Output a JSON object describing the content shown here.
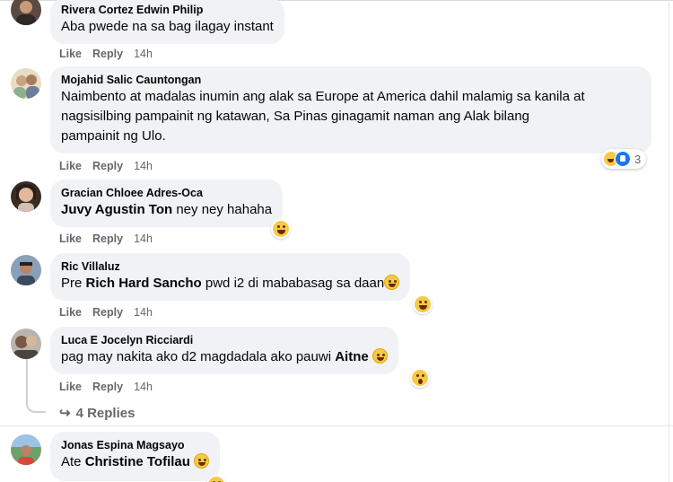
{
  "actions": {
    "like": "Like",
    "reply": "Reply"
  },
  "comments": [
    {
      "author": "Rivera Cortez Edwin Philip",
      "text": "Aba pwede na sa bag ilagay instant",
      "time": "14h"
    },
    {
      "author": "Mojahid Salic Cauntongan",
      "text_lines": [
        "Naimbento at madalas inumin ang alak sa Europe at America dahil malamig sa kanila at",
        "nagsisilbing pampainit ng katawan, Sa Pinas ginagamit naman ang Alak bilang",
        "pampainit ng Ulo."
      ],
      "time": "14h",
      "reaction_count": "3"
    },
    {
      "author": "Gracian Chloee Adres-Oca",
      "mention": "Juvy Agustin Ton",
      "text": " ney ney hahaha",
      "time": "14h"
    },
    {
      "author": "Ric Villaluz",
      "prefix": "Pre ",
      "mention": "Rich Hard Sancho",
      "text": " pwd i2 di mababasag sa daan",
      "time": "14h"
    },
    {
      "author": "Luca E Jocelyn Ricciardi",
      "text": "pag may nakita ako d2 magdadala ako pauwi ",
      "mention": "Aitne",
      "time": "14h"
    },
    {
      "author": "Jonas Espina Magsayo",
      "prefix": "Ate ",
      "mention": "Christine Tofilau"
    }
  ],
  "replies_link": "4 Replies",
  "icons": {
    "haha": "haha-reaction-icon",
    "like": "like-reaction-icon",
    "wow": "wow-reaction-icon",
    "reply_arrow": "reply-arrow-icon"
  },
  "colors": {
    "bubble": "#f0f2f5",
    "meta": "#65676b",
    "like_blue": "#1877f2"
  }
}
